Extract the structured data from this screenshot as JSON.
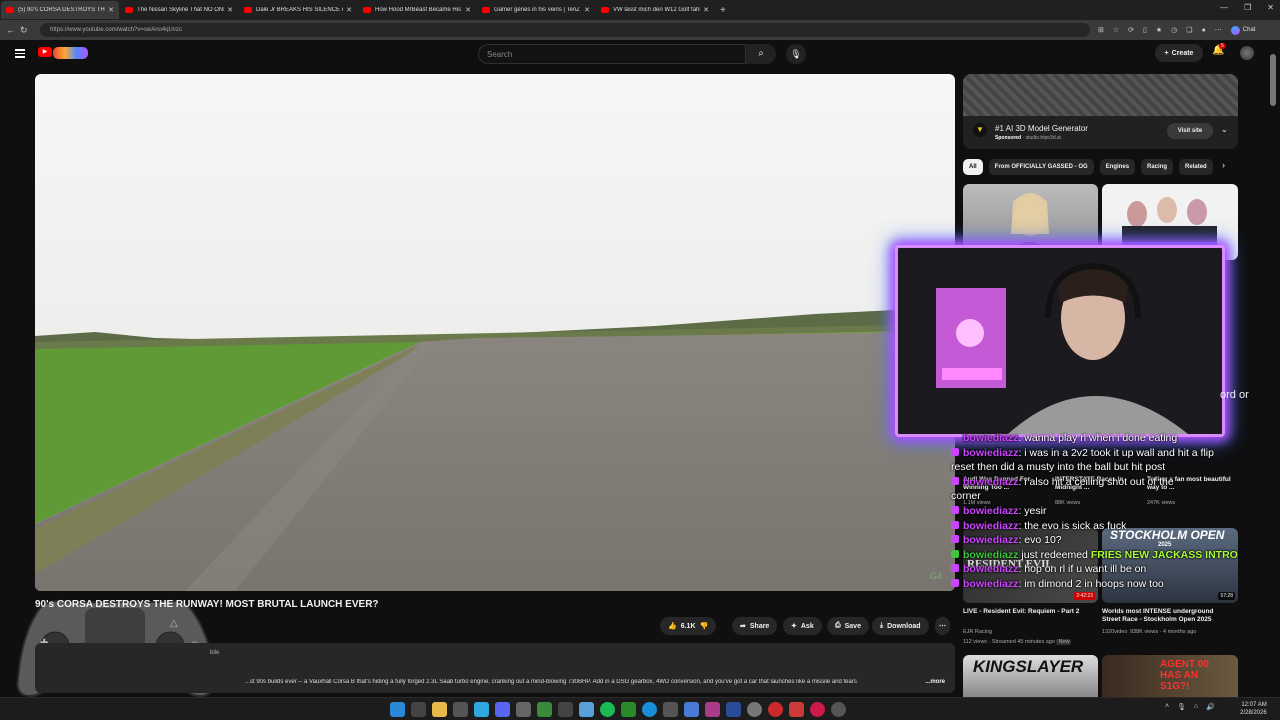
{
  "browser": {
    "tabs": [
      {
        "title": "(5) 90's CORSA DESTROYS TH",
        "active": true
      },
      {
        "title": "The Nissan Skyline That NO ONE K",
        "active": false
      },
      {
        "title": "Dale Jr BREAKS HIS SILENCE on Cl",
        "active": false
      },
      {
        "title": "How Hood MrBeast Became His M",
        "active": false
      },
      {
        "title": "Gamer genes in his veins | TenZ #s",
        "active": false
      },
      {
        "title": "VW lässt mich den W12 Golf fahre",
        "active": false
      }
    ],
    "url": "https://www.youtube.com/watch?v=swAno4qUvzc",
    "chat_label": "Chat"
  },
  "header": {
    "search_placeholder": "Search",
    "create_label": "Create",
    "notification_count": "5"
  },
  "video": {
    "title": "90's CORSA DESTROYS THE RUNWAY! MOST BRUTAL LAUNCH EVER?",
    "likes": "6.1K",
    "share_label": "Share",
    "ask_label": "Ask",
    "save_label": "Save",
    "download_label": "Download",
    "description": "...st 90s builds ever -- a Vauxhall Corsa B that's hiding a fully forged 2.3L Saab turbo engine, cranking out a mind-blowing 730BHP. Add in a DSG gearbox, 4WD conversion, and you've got a car that launches like a missile and tears",
    "more_label": "...more",
    "desc_partial": "bile"
  },
  "ad": {
    "title": "#1 AI 3D Model Generator",
    "sponsored": "Sponsored",
    "domain": "studio.tripo3d.ai",
    "visit_label": "Visit site"
  },
  "chips": [
    "All",
    "From OFFICIALLY GASSED - OG",
    "Engines",
    "Racing",
    "Related"
  ],
  "recommendations": [
    {
      "title": "Audi Was Banned For Winning Too ...",
      "meta": "1.1M views"
    },
    {
      "title": "INTERSTATE Races in Midnight ...",
      "meta": "88K views"
    },
    {
      "title": "Telling a fan most beautiful way to ...",
      "meta": "247K views"
    },
    {
      "title": "LIVE - Resident Evil: Requiem - Part 2",
      "channel": "EJR Racing",
      "meta": "112 views · Streamed 45 minutes ago",
      "badge": "New",
      "duration": "2:42:23",
      "thumb_text": "RESIDENT EVIL"
    },
    {
      "title": "Worlds most INTENSE underground Street Race - Stockholm Open 2025",
      "channel": "1320video",
      "meta": "938K views · 4 months ago",
      "duration": "57:28",
      "thumb_text": "STOCKHOLM OPEN",
      "thumb_sub": "2025"
    },
    {
      "thumb_text": "KINGSLAYER"
    },
    {
      "thumb_text": "AGENT 00 HAS AN S1G?!"
    }
  ],
  "overlay": {
    "fragment": "ord or",
    "chat": [
      {
        "user": "bowiediazz",
        "msg": ": wanna play rl when i done eating"
      },
      {
        "user": "bowiediazz",
        "msg": ": i was in a 2v2 took it up wall and hit a flip"
      },
      {
        "user": "",
        "msg": "reset then did a musty into the ball but hit post"
      },
      {
        "user": "bowiediazz",
        "msg": ": i also hit a ceiling shot out of the"
      },
      {
        "user": "",
        "msg": "corner"
      },
      {
        "user": "bowiediazz",
        "msg": ": yesir"
      },
      {
        "user": "bowiediazz",
        "msg": ": the evo is sick as fuck"
      },
      {
        "user": "bowiediazz",
        "msg": ": evo 10?"
      },
      {
        "user": "bowiediazz",
        "msg": " just redeemed ",
        "highlight": "FRIES NEW JACKASS INTRO"
      },
      {
        "user": "bowiediazz",
        "msg": ": hop on rl if u want ill be on"
      },
      {
        "user": "bowiediazz",
        "msg": ": im dimond 2 in hoops now too"
      }
    ]
  },
  "taskbar": {
    "time": "12:07 AM",
    "date": "2/28/2026"
  },
  "colors": {
    "youtube_red": "#ff0000",
    "chat_user": "#cc44ff",
    "webcam_glow": "#b44dff",
    "redeem_highlight": "#aaff33"
  }
}
